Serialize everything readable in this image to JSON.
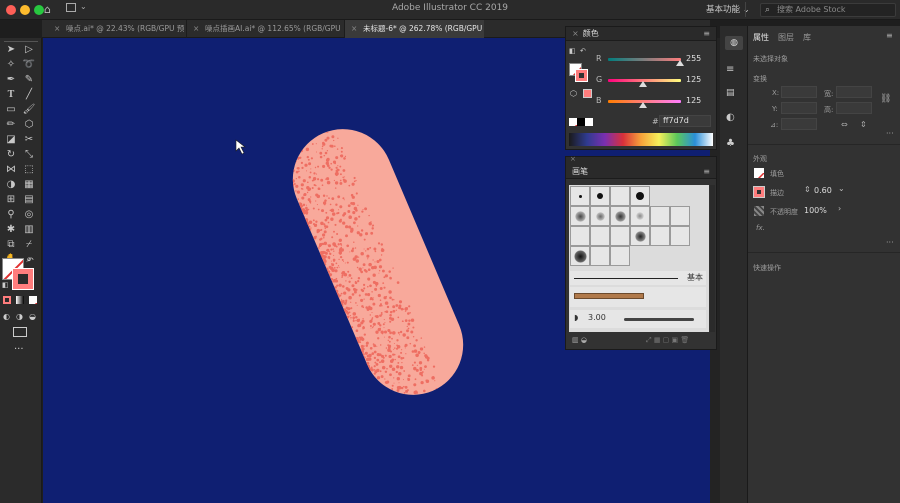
{
  "app": {
    "title": "Adobe Illustrator CC 2019",
    "workspace": "基本功能",
    "stock_placeholder": "搜索 Adobe Stock"
  },
  "tabs": [
    {
      "label": "噪点.ai* @ 22.43% (RGB/GPU 预览)",
      "active": false
    },
    {
      "label": "噪点插画AI.ai* @ 112.65% (RGB/GPU 预览)",
      "active": false
    },
    {
      "label": "未标题-6* @ 262.78% (RGB/GPU 预览)",
      "active": true
    }
  ],
  "color_panel": {
    "title": "颜色",
    "channels": [
      {
        "label": "R",
        "value": "255",
        "level": 1.0
      },
      {
        "label": "G",
        "value": "125",
        "level": 0.49
      },
      {
        "label": "B",
        "value": "125",
        "level": 0.49
      }
    ],
    "hex_label": "#",
    "hex": "ff7d7d"
  },
  "brush_panel": {
    "title": "画笔",
    "basic_label": "基本",
    "stroke_size": "3.00"
  },
  "properties": {
    "tabs": [
      "属性",
      "图层",
      "库"
    ],
    "no_selection": "未选择对象",
    "transform": "变换",
    "x_label": "X:",
    "y_label": "Y:",
    "w_label": "宽:",
    "h_label": "高:",
    "angle_label": "⊿:",
    "appearance": "外观",
    "fill_label": "填色",
    "stroke_label": "描边",
    "stroke_value": "0.60",
    "opacity_label": "不透明度",
    "opacity_value": "100%",
    "fx_label": "fx.",
    "quick_actions": "快速操作"
  },
  "colors": {
    "accent": "#ff7d7d",
    "canvas": "#0f1f72",
    "pill": "#f8a99b",
    "noise": "#ee6e62"
  }
}
